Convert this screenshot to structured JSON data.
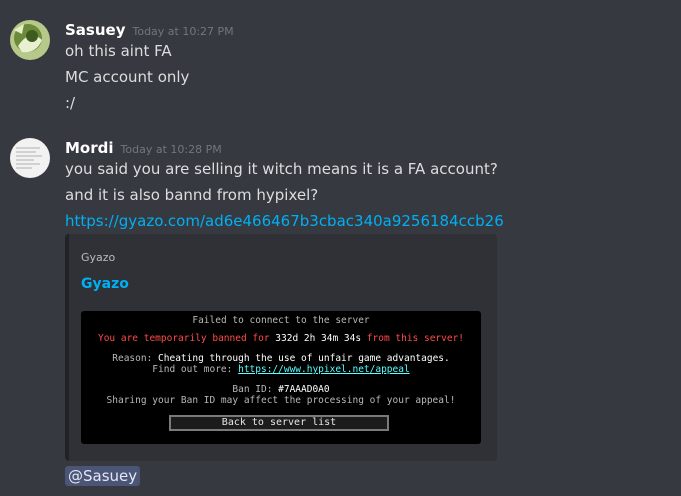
{
  "messages": [
    {
      "username": "Sasuey",
      "timestamp": "Today at 10:27 PM",
      "lines": [
        "oh this aint FA",
        "MC account only",
        ":/"
      ]
    },
    {
      "username": "Mordi",
      "timestamp": "Today at 10:28 PM",
      "lines": [
        "you said you are selling it witch means it is a FA account?",
        "and it is also bannd from hypixel?"
      ],
      "link": "https://gyazo.com/ad6e466467b3cbac340a9256184ccb26",
      "embed": {
        "provider": "Gyazo",
        "title": "Gyazo",
        "image": {
          "header": "Failed to connect to the server",
          "ban_prefix": "You are temporarily banned for ",
          "ban_duration": "332d 2h 34m 34s",
          "ban_suffix": " from this server!",
          "reason_label": "Reason: ",
          "reason_text": "Cheating through the use of unfair game advantages.",
          "findout_label": "Find out more: ",
          "findout_link": "https://www.hypixel.net/appeal",
          "banid_label": "Ban ID: ",
          "banid_value": "#7AAAD0A0",
          "sharing_text": "Sharing your Ban ID may affect the processing of your appeal!",
          "button_label": "Back to server list"
        }
      },
      "mention": "@Sasuey"
    }
  ],
  "colors": {
    "background": "#36393f",
    "link": "#00b0f4",
    "embed_bg": "#2f3136",
    "mention_bg": "#4a5283"
  }
}
